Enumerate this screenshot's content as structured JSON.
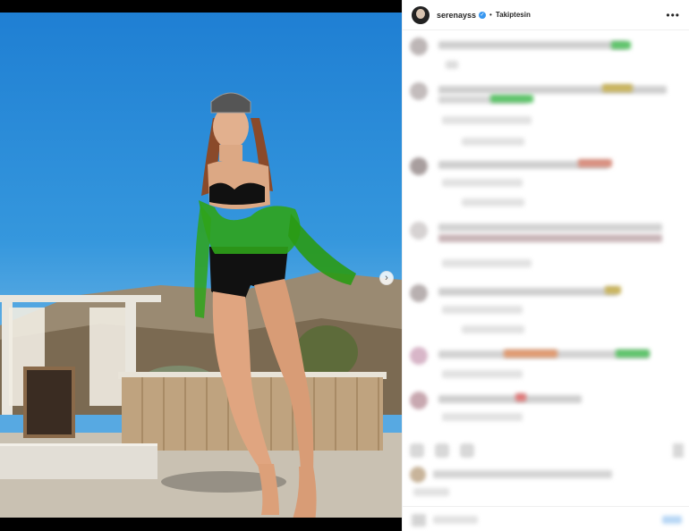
{
  "post": {
    "username": "serenayss",
    "follow_status": "Takiptesin",
    "separator": "•",
    "verified_glyph": "✓",
    "more_glyph": "•••",
    "next_glyph": "›",
    "carousel_count": 3,
    "carousel_active": 1
  },
  "icons": {
    "verified": "verified-badge-icon",
    "more": "more-options-icon",
    "next": "chevron-right-icon"
  },
  "colors": {
    "accent": "#3897f0",
    "text": "#262626"
  }
}
